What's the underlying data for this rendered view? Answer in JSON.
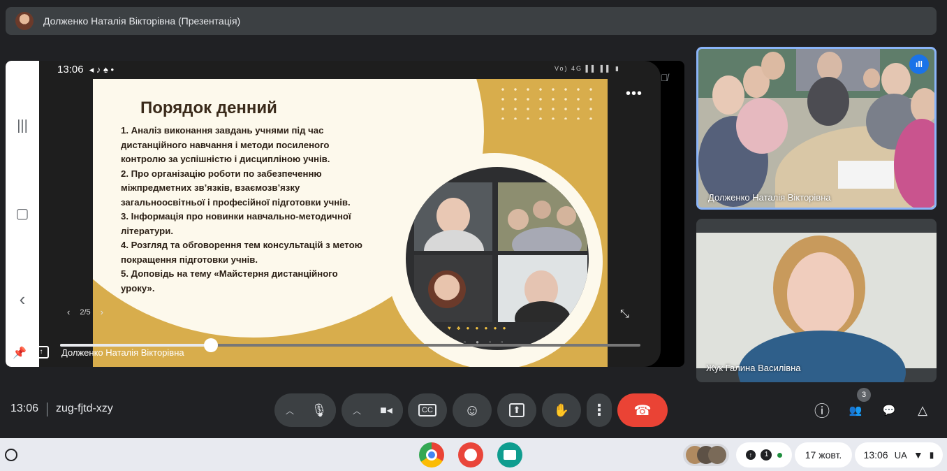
{
  "window": {
    "presenter_title": "Долженко Наталія Вікторівна (Презентація)"
  },
  "phone": {
    "status_time": "13:06",
    "status_icons": "◂ ♪ ♠ •",
    "status_right": "Vo) 4G ▌▌ ▌▌ ▮",
    "nav": {
      "menu": "|||",
      "home": "▢",
      "back": "‹"
    }
  },
  "slide": {
    "title": "Порядок денний",
    "items": [
      "1. Аналіз виконання завдань учнями під час дистанційного навчання і методи посиленого контролю за успішністю і дисципліною учнів.",
      "2.  Про організацію роботи по забезпеченню міжпредметних зв’язків, взаємозв’язку загальноосвітньої і професійної підготовки учнів.",
      "3.  Інформація про новинки навчально-методичної літератури.",
      "4.  Розгляд та обговорення тем консультацій з метою покращення підготовки учнів.",
      "5.  Доповідь на тему «Майстерня дистанційного уроку»."
    ],
    "page_indicator": "2/5"
  },
  "stage": {
    "presenter_name": "Долженко Наталія Вікторівна",
    "progress": 0.26
  },
  "participants": [
    {
      "name": "Долженко Наталія Вікторівна",
      "speaking": true
    },
    {
      "name": "Жук Галина Василівна",
      "speaking": false
    }
  ],
  "meeting": {
    "time": "13:06",
    "code": "zug-fjtd-xzy",
    "people_count": "3"
  },
  "icons": {
    "mic": "🎤",
    "camera": "▭",
    "cc": "CC",
    "emoji": "☺",
    "present": "⬆",
    "hand": "✋",
    "more": "⋮",
    "end": "☎",
    "info": "ⓘ",
    "people": "👥",
    "chat": "💬",
    "activities": "△"
  },
  "shelf": {
    "tray_count": "1",
    "date": "17 жовт.",
    "time": "13:06",
    "lang": "UA"
  },
  "colors": {
    "accent": "#8ab4f8",
    "end_call": "#ea4335",
    "slide_gold": "#d8ad4c",
    "slide_cream": "#fdf9ec"
  }
}
